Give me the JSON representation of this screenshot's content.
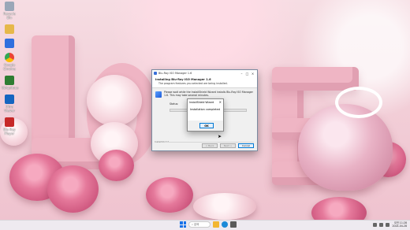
{
  "desktop": {
    "icons": [
      {
        "label": "Recycle Bin",
        "icon": "recycle-bin-icon",
        "color": "#9aa7b8"
      },
      {
        "label": "",
        "icon": "folder-icon",
        "color": "#e6b84a"
      },
      {
        "label": "",
        "icon": "app-icon",
        "color": "#2f6fde"
      },
      {
        "label": "Google Chrome",
        "icon": "chrome-icon",
        "color": "#34a853"
      },
      {
        "label": "Ubiquitous",
        "icon": "app-icon",
        "color": "#2e7d32"
      },
      {
        "label": "Ultra Viewer",
        "icon": "app-icon",
        "color": "#1565c0"
      },
      {
        "label": "Blu-Ray Player",
        "icon": "app-icon",
        "color": "#c62828"
      }
    ]
  },
  "installer": {
    "window_title": "Blu-Ray ISO Manager 1.6",
    "header_title": "Installing Blu-Ray ISO Manager 1.6",
    "header_subtitle": "The program features you selected are being installed.",
    "body_text": "Please wait while the InstallShield Wizard installs Blu-Ray ISO Manager 1.6. This may take several minutes.",
    "status_label": "Status:",
    "progress": 0,
    "footer_label": "InstallShield",
    "buttons": {
      "back": "< Back",
      "next": "Next >",
      "cancel": "Cancel"
    }
  },
  "dialog": {
    "title": "InstallShield Wizard",
    "message": "Installation completed",
    "ok_label": "OK"
  },
  "taskbar": {
    "search_placeholder": "검색",
    "apps": [
      {
        "icon": "file-explorer-icon",
        "color": "#f2b632"
      },
      {
        "icon": "edge-icon",
        "color": "#1b8ad8"
      },
      {
        "icon": "app-icon",
        "color": "#5a5a5a"
      }
    ],
    "time": "오전 11:28",
    "date": "2024-04-28"
  }
}
